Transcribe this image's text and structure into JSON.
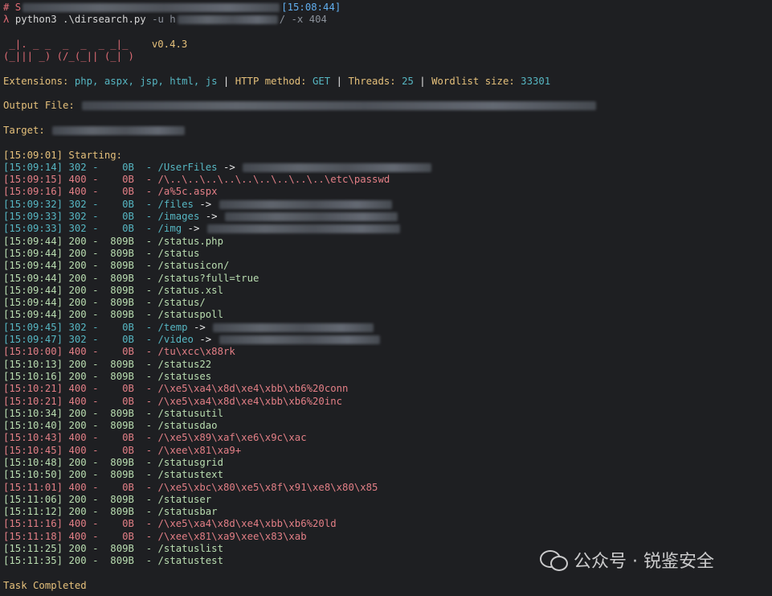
{
  "header": {
    "comment_prefix": "# S",
    "timestamp": "[15:08:44]",
    "prompt_symbol": "λ",
    "command": "python3 .\\dirsearch.py",
    "flag_u": "-u h",
    "flag_x": "/ -x 404"
  },
  "banner": {
    "art_line1": " _|. _ _  _  _  _ _|_",
    "art_line2": "(_||| _) (/_(_|| (_| )",
    "version": "v0.4.3"
  },
  "config": {
    "extensions_label": "Extensions: ",
    "extensions_value": "php, aspx, jsp, html, js",
    "sep": " | ",
    "http_label": "HTTP method: ",
    "http_value": "GET",
    "threads_label": "Threads: ",
    "threads_value": "25",
    "wordlist_label": "Wordlist size: ",
    "wordlist_value": "33301"
  },
  "output_file_label": "Output File: ",
  "target_label": "Target: ",
  "starting": "[15:09:01] Starting:",
  "rows": [
    {
      "time": "[15:09:14]",
      "code": "302",
      "size": "0B",
      "path": "/UserFiles",
      "redirect": true
    },
    {
      "time": "[15:09:15]",
      "code": "400",
      "size": "0B",
      "path": "/\\..\\..\\..\\..\\..\\..\\..\\..\\..\\etc\\passwd",
      "redirect": false
    },
    {
      "time": "[15:09:16]",
      "code": "400",
      "size": "0B",
      "path": "/a%5c.aspx",
      "redirect": false
    },
    {
      "time": "[15:09:32]",
      "code": "302",
      "size": "0B",
      "path": "/files",
      "redirect": true
    },
    {
      "time": "[15:09:33]",
      "code": "302",
      "size": "0B",
      "path": "/images",
      "redirect": true
    },
    {
      "time": "[15:09:33]",
      "code": "302",
      "size": "0B",
      "path": "/img",
      "redirect": true
    },
    {
      "time": "[15:09:44]",
      "code": "200",
      "size": "809B",
      "path": "/status.php",
      "redirect": false
    },
    {
      "time": "[15:09:44]",
      "code": "200",
      "size": "809B",
      "path": "/status",
      "redirect": false
    },
    {
      "time": "[15:09:44]",
      "code": "200",
      "size": "809B",
      "path": "/statusicon/",
      "redirect": false
    },
    {
      "time": "[15:09:44]",
      "code": "200",
      "size": "809B",
      "path": "/status?full=true",
      "redirect": false
    },
    {
      "time": "[15:09:44]",
      "code": "200",
      "size": "809B",
      "path": "/status.xsl",
      "redirect": false
    },
    {
      "time": "[15:09:44]",
      "code": "200",
      "size": "809B",
      "path": "/status/",
      "redirect": false
    },
    {
      "time": "[15:09:44]",
      "code": "200",
      "size": "809B",
      "path": "/statuspoll",
      "redirect": false
    },
    {
      "time": "[15:09:45]",
      "code": "302",
      "size": "0B",
      "path": "/temp",
      "redirect": true
    },
    {
      "time": "[15:09:47]",
      "code": "302",
      "size": "0B",
      "path": "/video",
      "redirect": true
    },
    {
      "time": "[15:10:00]",
      "code": "400",
      "size": "0B",
      "path": "/tu\\xcc\\x88rk",
      "redirect": false
    },
    {
      "time": "[15:10:13]",
      "code": "200",
      "size": "809B",
      "path": "/status22",
      "redirect": false
    },
    {
      "time": "[15:10:16]",
      "code": "200",
      "size": "809B",
      "path": "/statuses",
      "redirect": false
    },
    {
      "time": "[15:10:21]",
      "code": "400",
      "size": "0B",
      "path": "/\\xe5\\xa4\\x8d\\xe4\\xbb\\xb6%20conn",
      "redirect": false
    },
    {
      "time": "[15:10:21]",
      "code": "400",
      "size": "0B",
      "path": "/\\xe5\\xa4\\x8d\\xe4\\xbb\\xb6%20inc",
      "redirect": false
    },
    {
      "time": "[15:10:34]",
      "code": "200",
      "size": "809B",
      "path": "/statusutil",
      "redirect": false
    },
    {
      "time": "[15:10:40]",
      "code": "200",
      "size": "809B",
      "path": "/statusdao",
      "redirect": false
    },
    {
      "time": "[15:10:43]",
      "code": "400",
      "size": "0B",
      "path": "/\\xe5\\x89\\xaf\\xe6\\x9c\\xac",
      "redirect": false
    },
    {
      "time": "[15:10:45]",
      "code": "400",
      "size": "0B",
      "path": "/\\xee\\x81\\xa9+",
      "redirect": false
    },
    {
      "time": "[15:10:48]",
      "code": "200",
      "size": "809B",
      "path": "/statusgrid",
      "redirect": false
    },
    {
      "time": "[15:10:50]",
      "code": "200",
      "size": "809B",
      "path": "/statustext",
      "redirect": false
    },
    {
      "time": "[15:11:01]",
      "code": "400",
      "size": "0B",
      "path": "/\\xe5\\xbc\\x80\\xe5\\x8f\\x91\\xe8\\x80\\x85",
      "redirect": false
    },
    {
      "time": "[15:11:06]",
      "code": "200",
      "size": "809B",
      "path": "/statuser",
      "redirect": false
    },
    {
      "time": "[15:11:12]",
      "code": "200",
      "size": "809B",
      "path": "/statusbar",
      "redirect": false
    },
    {
      "time": "[15:11:16]",
      "code": "400",
      "size": "0B",
      "path": "/\\xe5\\xa4\\x8d\\xe4\\xbb\\xb6%20ld",
      "redirect": false
    },
    {
      "time": "[15:11:18]",
      "code": "400",
      "size": "0B",
      "path": "/\\xee\\x81\\xa9\\xee\\x83\\xab",
      "redirect": false
    },
    {
      "time": "[15:11:25]",
      "code": "200",
      "size": "809B",
      "path": "/statuslist",
      "redirect": false
    },
    {
      "time": "[15:11:35]",
      "code": "200",
      "size": "809B",
      "path": "/statustest",
      "redirect": false
    }
  ],
  "redirect_arrow": " ->",
  "task_completed": "Task Completed",
  "watermark": {
    "icon": "wechat-icon",
    "text": "公众号 · 锐鉴安全"
  },
  "colors": {
    "background": "#1e1f22",
    "status_200": "#b9ddb0",
    "status_302": "#56b6c2",
    "status_400": "#e37f86",
    "accent_yellow": "#e5c07b",
    "banner_red": "#e06c75"
  }
}
